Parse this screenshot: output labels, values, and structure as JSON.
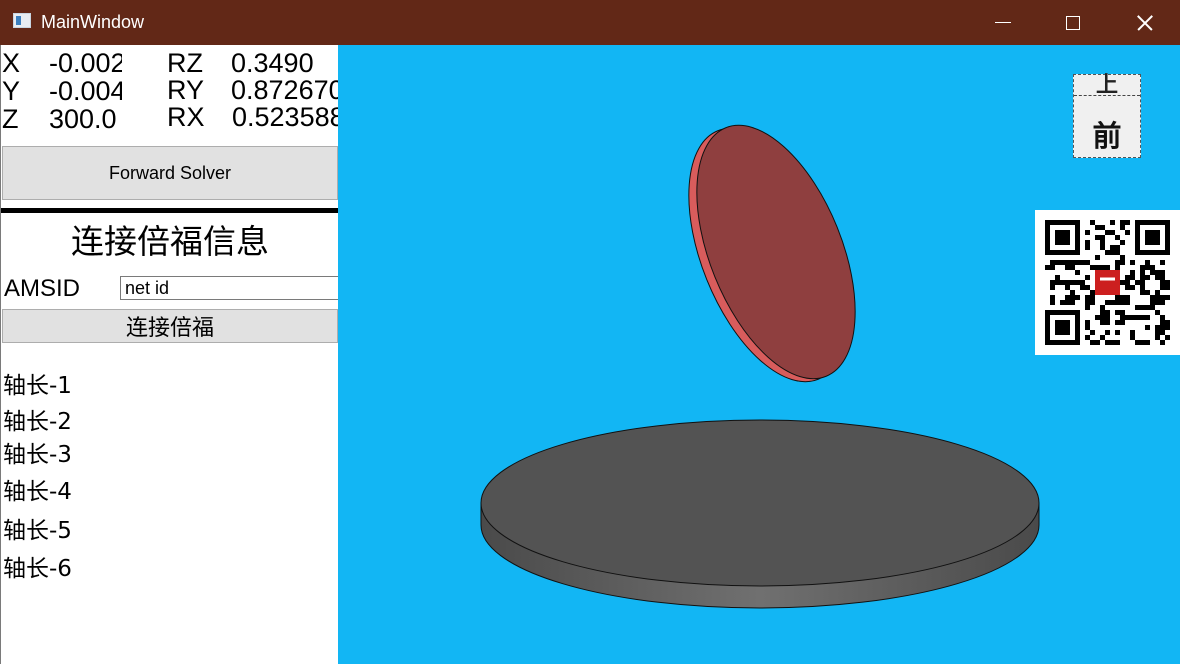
{
  "window": {
    "title": "MainWindow"
  },
  "coords": {
    "x_label": "X",
    "x_value": "-0.002",
    "y_label": "Y",
    "y_value": "-0.004",
    "z_label": "Z",
    "z_value": "300.0",
    "rz_label": "RZ",
    "rz_value": "0.3490",
    "ry_label": "RY",
    "ry_value": "0.872670",
    "rx_label": "RX",
    "rx_value": "0.523588"
  },
  "forward_button": "Forward Solver",
  "section_title": "连接倍福信息",
  "amsid": {
    "label": "AMSID",
    "value": "net id"
  },
  "connect_button": "连接倍福",
  "axes": [
    "轴长-1",
    "轴长-2",
    "轴长-3",
    "轴长-4",
    "轴长-5",
    "轴长-6"
  ],
  "view_cube": {
    "top": "上",
    "front": "前"
  },
  "colors": {
    "title_bar": "#622817",
    "viewport": "#12b6f4",
    "upper_disk": "#8f3f3f",
    "upper_disk_edge": "#d85c5c",
    "base_disk": "#535353"
  }
}
